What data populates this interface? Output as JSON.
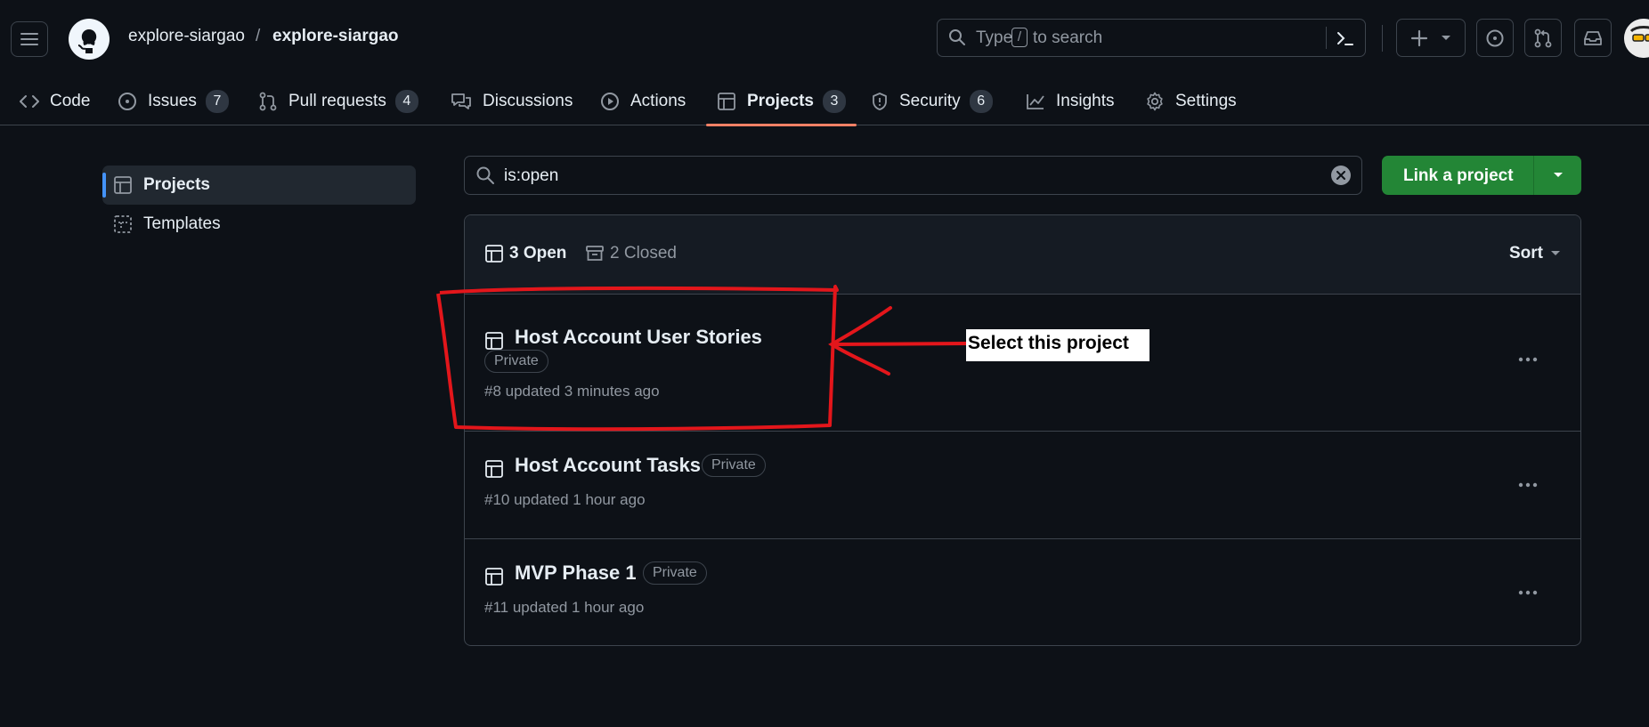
{
  "header": {
    "owner": "explore-siargao",
    "separator": "/",
    "repo": "explore-siargao",
    "search": {
      "prefix": "Type",
      "key": "/",
      "suffix": "to search"
    }
  },
  "nav": {
    "tabs": [
      {
        "label": "Code",
        "icon": "code-icon"
      },
      {
        "label": "Issues",
        "count": "7",
        "icon": "issue-icon"
      },
      {
        "label": "Pull requests",
        "count": "4",
        "icon": "pull-request-icon"
      },
      {
        "label": "Discussions",
        "icon": "discussions-icon"
      },
      {
        "label": "Actions",
        "icon": "play-icon"
      },
      {
        "label": "Projects",
        "count": "3",
        "icon": "table-icon",
        "active": true
      },
      {
        "label": "Security",
        "count": "6",
        "icon": "shield-icon"
      },
      {
        "label": "Insights",
        "icon": "graph-icon"
      },
      {
        "label": "Settings",
        "icon": "gear-icon"
      }
    ]
  },
  "sidebar": {
    "items": [
      {
        "label": "Projects",
        "active": true,
        "icon": "table-icon"
      },
      {
        "label": "Templates",
        "icon": "template-icon"
      }
    ]
  },
  "filter": {
    "value": "is:open"
  },
  "link_button": {
    "label": "Link a project"
  },
  "list": {
    "open_label": "3 Open",
    "closed_label": "2 Closed",
    "sort_label": "Sort",
    "projects": [
      {
        "title": "Host Account User Stories",
        "badge": "Private",
        "meta": "#8 updated 3 minutes ago"
      },
      {
        "title": "Host Account Tasks",
        "badge": "Private",
        "meta": "#10 updated 1 hour ago"
      },
      {
        "title": "MVP Phase 1",
        "badge": "Private",
        "meta": "#11 updated 1 hour ago"
      }
    ]
  },
  "annotation": {
    "text": "Select this project",
    "color": "#e3161b"
  },
  "colors": {
    "background": "#0d1117",
    "accent_underline": "#f78166",
    "primary_button": "#238636",
    "muted_text": "#9198a1"
  }
}
